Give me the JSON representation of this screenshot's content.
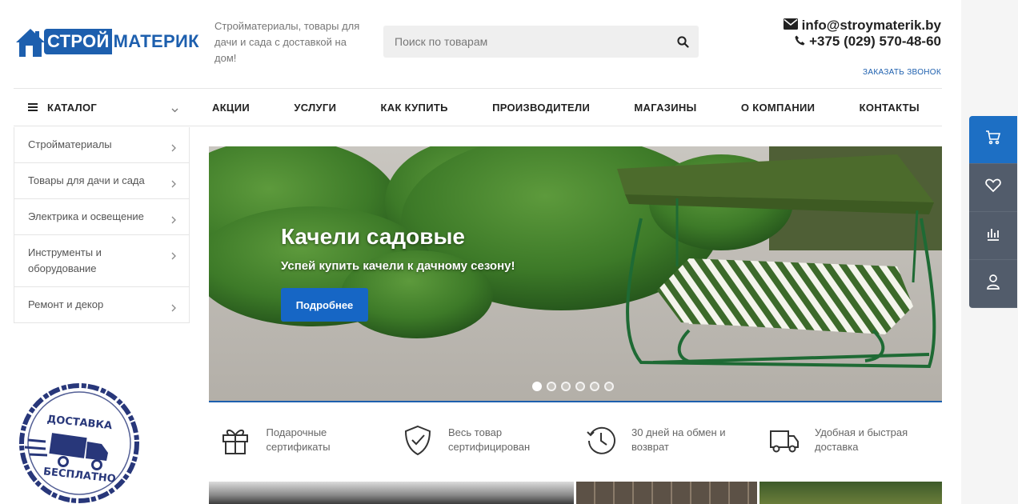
{
  "header": {
    "logo": {
      "part1": "СТРОЙ",
      "part2": "МАТЕРИК"
    },
    "tagline": "Стройматериалы, товары для дачи и сада с доставкой на дом!",
    "search_placeholder": "Поиск по товарам",
    "email": "info@stroymaterik.by",
    "phone": "+375 (029) 570-48-60",
    "order_call": "ЗАКАЗАТЬ ЗВОНОК"
  },
  "nav": {
    "catalog": "КАТАЛОГ",
    "items": [
      "АКЦИИ",
      "УСЛУГИ",
      "КАК КУПИТЬ",
      "ПРОИЗВОДИТЕЛИ",
      "МАГАЗИНЫ",
      "О КОМПАНИИ",
      "КОНТАКТЫ"
    ]
  },
  "sidebar": {
    "items": [
      {
        "label": "Стройматериалы"
      },
      {
        "label": "Товары для дачи и сада"
      },
      {
        "label": "Электрика и освещение"
      },
      {
        "label": "Инструменты и оборудование"
      },
      {
        "label": "Ремонт и декор"
      }
    ]
  },
  "promo": {
    "line1": "ДОСТАВКА",
    "line2": "БЕСПЛАТНО"
  },
  "banner": {
    "title": "Качели садовые",
    "subtitle": "Успей купить качели к дачному сезону!",
    "button": "Подробнее",
    "slides": 6,
    "active_slide": 1
  },
  "features": [
    {
      "icon": "gift-icon",
      "text": "Подарочные сертификаты"
    },
    {
      "icon": "shield-check-icon",
      "text": "Весь товар сертифицирован"
    },
    {
      "icon": "history-icon",
      "text": "30 дней на обмен и возврат"
    },
    {
      "icon": "truck-icon",
      "text": "Удобная и быстрая доставка"
    }
  ],
  "rail": [
    "cart-icon",
    "heart-icon",
    "compare-icon",
    "user-icon"
  ],
  "colors": {
    "brand": "#1d5fae",
    "button": "#1666c5",
    "rail": "#525c6b"
  }
}
